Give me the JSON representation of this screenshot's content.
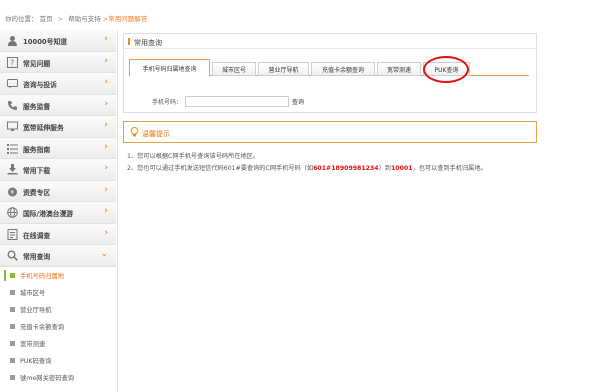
{
  "breadcrumb": {
    "prefix": "你的位置：",
    "home": "首页",
    "sep": ">",
    "section": "帮助与支持",
    "current": ">常用问题解答"
  },
  "sidebar": {
    "items": [
      {
        "label": "10000号知道",
        "icon": "user-icon"
      },
      {
        "label": "常见问题",
        "icon": "question-icon"
      },
      {
        "label": "咨询与投诉",
        "icon": "chat-icon"
      },
      {
        "label": "服务监督",
        "icon": "phone-icon"
      },
      {
        "label": "宽带延伸服务",
        "icon": "monitor-icon"
      },
      {
        "label": "服务指南",
        "icon": "list-icon"
      },
      {
        "label": "常用下载",
        "icon": "download-icon"
      },
      {
        "label": "资费专区",
        "icon": "money-icon"
      },
      {
        "label": "国际/港澳台漫游",
        "icon": "globe-icon"
      },
      {
        "label": "在线调查",
        "icon": "survey-icon"
      },
      {
        "label": "常用查询",
        "icon": "search-icon"
      }
    ],
    "chevron": "›",
    "open_chevron": "⌄",
    "subitems": [
      {
        "label": "手机号码归属地"
      },
      {
        "label": "城市区号"
      },
      {
        "label": "营业厅导航"
      },
      {
        "label": "充值卡余额查询"
      },
      {
        "label": "宽带测速"
      },
      {
        "label": "PUK码查询"
      },
      {
        "label": "號me网关密码查询"
      }
    ]
  },
  "panel": {
    "title": "常用查询",
    "tabs": [
      "手机号码归属地查询",
      "城市区号",
      "营业厅导航",
      "充值卡余额查询",
      "宽带测速",
      "PUK查询"
    ],
    "active_tab": 0,
    "phone_label": "手机号码：",
    "phone_value": "",
    "query_button": "查询"
  },
  "tips": {
    "title": "温馨提示",
    "line1": "1、您可以根据C网手机号查询该号码所在地区。",
    "line2_a": "2、您也可以通过手机发送短信代码",
    "line2_b": "601#18909981234",
    "line2_c": "（如",
    "line2_d": "601#手机号码",
    "line2_full_pre": "2、您也可以通过手机发送短信代码601#要查询的C网手机号码（如",
    "line2_hl1": "601#18909981234",
    "line2_mid": "）到",
    "line2_hl2": "10001",
    "line2_post": "，也可以查到手机归属地。"
  },
  "colors": {
    "accent": "#f08a1a",
    "active_green": "#8aba2e",
    "highlight_red": "#e60c0c",
    "annotation_circle": "#e01010"
  }
}
